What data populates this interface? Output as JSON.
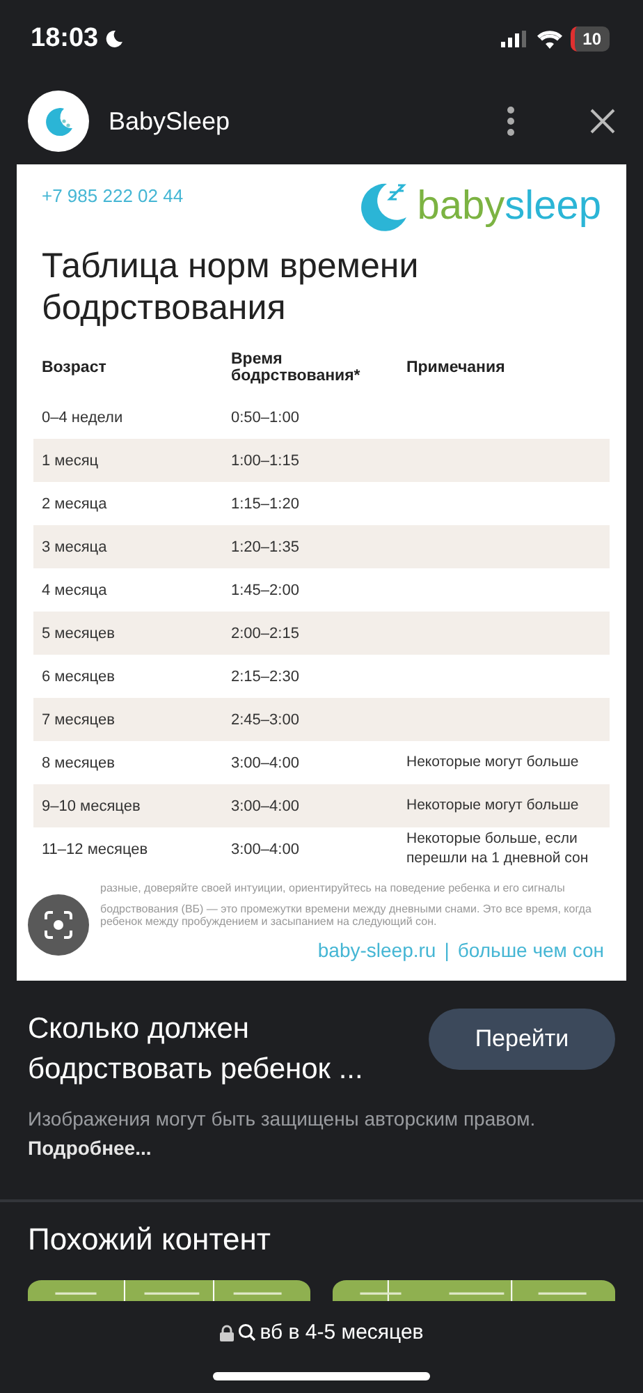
{
  "status_bar": {
    "time": "18:03",
    "battery": "10"
  },
  "header": {
    "site_name": "BabySleep"
  },
  "image": {
    "phone": "+7 985 222 02 44",
    "logo_text_1": "baby",
    "logo_text_2": "sleep",
    "title": "Таблица норм времени бодрствования",
    "table": {
      "columns": [
        "Возраст",
        "Время бодрствования*",
        "Примечания"
      ],
      "rows": [
        [
          "0–4 недели",
          "0:50–1:00",
          ""
        ],
        [
          "1 месяц",
          "1:00–1:15",
          ""
        ],
        [
          "2 месяца",
          "1:15–1:20",
          ""
        ],
        [
          "3 месяца",
          "1:20–1:35",
          ""
        ],
        [
          "4 месяца",
          "1:45–2:00",
          ""
        ],
        [
          "5 месяцев",
          "2:00–2:15",
          ""
        ],
        [
          "6 месяцев",
          "2:15–2:30",
          ""
        ],
        [
          "7 месяцев",
          "2:45–3:00",
          ""
        ],
        [
          "8 месяцев",
          "3:00–4:00",
          "Некоторые могут больше"
        ],
        [
          "9–10 месяцев",
          "3:00–4:00",
          "Некоторые могут больше"
        ],
        [
          "11–12 месяцев",
          "3:00–4:00",
          "Некоторые больше, если перешли на 1 дневной сон"
        ]
      ]
    },
    "footnotes": [
      "разные, доверяйте своей интуиции, ориентируйтесь на поведение ребенка и его сигналы",
      "бодрствования (ВБ) — это промежутки времени между дневными снами. Это все время, когда ребенок между пробуждением и засыпанием на следующий сон."
    ],
    "site_link": "baby-sleep.ru",
    "separator": "|",
    "slogan": "больше чем сон"
  },
  "result": {
    "title": "Сколько должен бодрствовать ребенок ...",
    "button": "Перейти",
    "notice": "Изображения могут быть защищены авторским правом. **Подробнее...**"
  },
  "similar": {
    "title": "Похожий контент"
  },
  "address_bar": {
    "query": "вб в 4-5 месяцев"
  }
}
